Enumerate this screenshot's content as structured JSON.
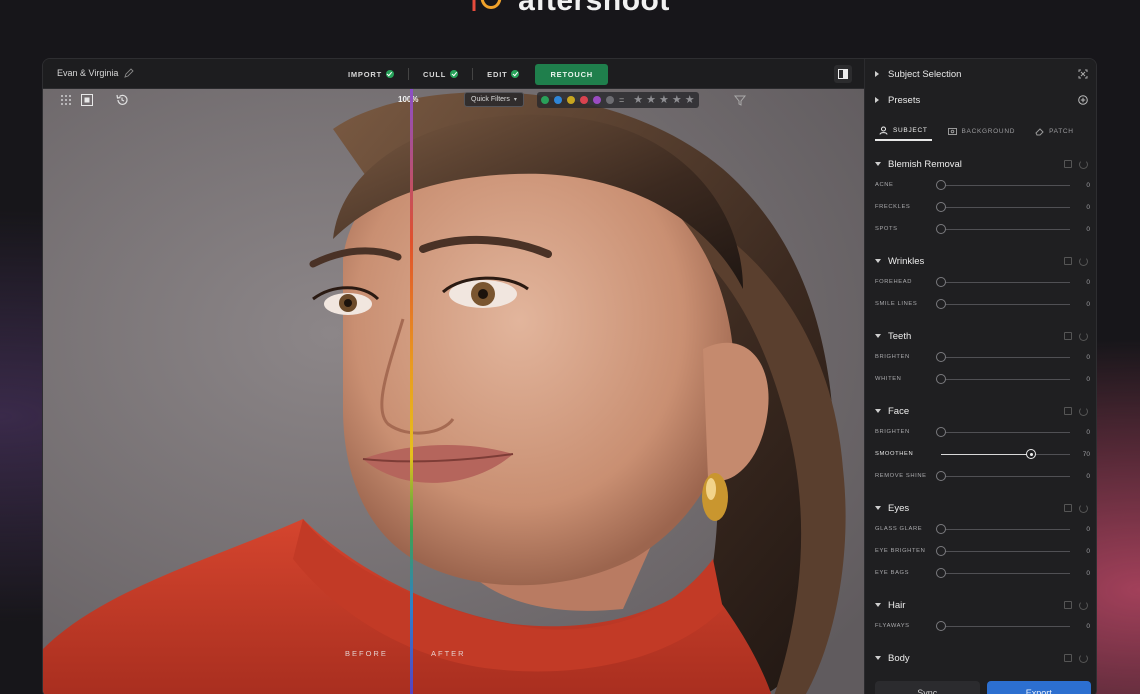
{
  "brand": {
    "name": "aftershoot"
  },
  "topbar": {
    "project_name": "Evan & Virginia",
    "steps": [
      {
        "label": "IMPORT"
      },
      {
        "label": "CULL"
      },
      {
        "label": "EDIT"
      }
    ],
    "active_step": "RETOUCH"
  },
  "viewer": {
    "zoom": "100%",
    "quick_filters_label": "Quick Filters",
    "color_labels": [
      "#2aa05a",
      "#2f86d8",
      "#c7a51f",
      "#d9434f",
      "#9a4bc2",
      "#6d6d72"
    ],
    "stars": [
      "★",
      "★",
      "★",
      "★",
      "★"
    ],
    "before_label": "BEFORE",
    "after_label": "AFTER"
  },
  "sidebar": {
    "subject_selection": "Subject Selection",
    "presets": "Presets",
    "tabs": [
      {
        "label": "SUBJECT"
      },
      {
        "label": "BACKGROUND"
      },
      {
        "label": "PATCH"
      }
    ],
    "sections": [
      {
        "title": "Blemish Removal",
        "sliders": [
          {
            "label": "ACNE",
            "value": "0"
          },
          {
            "label": "FRECKLES",
            "value": "0"
          },
          {
            "label": "SPOTS",
            "value": "0"
          }
        ]
      },
      {
        "title": "Wrinkles",
        "sliders": [
          {
            "label": "FOREHEAD",
            "value": "0"
          },
          {
            "label": "SMILE LINES",
            "value": "0"
          }
        ]
      },
      {
        "title": "Teeth",
        "sliders": [
          {
            "label": "BRIGHTEN",
            "value": "0"
          },
          {
            "label": "WHITEN",
            "value": "0"
          }
        ]
      },
      {
        "title": "Face",
        "sliders": [
          {
            "label": "BRIGHTEN",
            "value": "0"
          },
          {
            "label": "SMOOTHEN",
            "value": "70"
          },
          {
            "label": "REMOVE SHINE",
            "value": "0"
          }
        ]
      },
      {
        "title": "Eyes",
        "sliders": [
          {
            "label": "GLASS GLARE",
            "value": "0"
          },
          {
            "label": "EYE BRIGHTEN",
            "value": "0"
          },
          {
            "label": "EYE BAGS",
            "value": "0"
          }
        ]
      },
      {
        "title": "Hair",
        "sliders": [
          {
            "label": "FLYAWAYS",
            "value": "0"
          }
        ]
      },
      {
        "title": "Body",
        "sliders": []
      }
    ],
    "sync_label": "Sync",
    "export_label": "Export"
  }
}
